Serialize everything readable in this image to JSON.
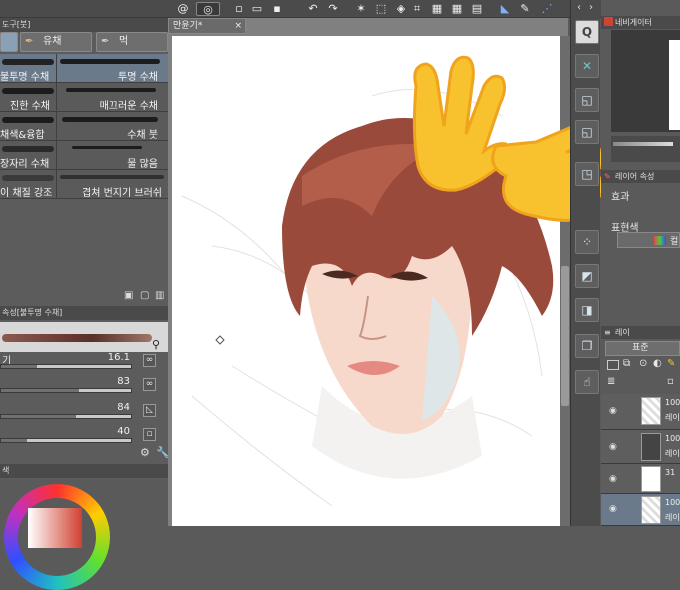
{
  "toolbar": {
    "icons": [
      "spiral-icon",
      "new-file-icon",
      "open-folder-icon",
      "save-icon",
      "undo-icon",
      "redo-icon",
      "sparkle-icon",
      "transform-icon",
      "bucket-icon",
      "crop-icon",
      "ruler-icon",
      "pen-icon"
    ]
  },
  "brush_panel": {
    "title": "도구[붓]",
    "tabs": [
      {
        "label": "유채"
      },
      {
        "label": "먹"
      }
    ],
    "brushes": [
      {
        "left": "불투명 수채",
        "right": "투명 수채",
        "selected": true
      },
      {
        "left": "진한 수채",
        "right": "매끄러운 수채",
        "selected": false
      },
      {
        "left": "채색&융합",
        "right": "수채 붓",
        "selected": false
      },
      {
        "left": "장자리 수채",
        "right": "물 많음",
        "selected": false
      },
      {
        "left": "이 채질 강조",
        "right": "겹쳐 번지기 브러쉬",
        "selected": false
      }
    ]
  },
  "property_panel": {
    "title": "속성[불투명 수채]",
    "sliders": [
      {
        "label": "기",
        "value": "16.1",
        "fraction": 0.28
      },
      {
        "label": "",
        "value": "83",
        "fraction": 0.6
      },
      {
        "label": "",
        "value": "84",
        "fraction": 0.58
      },
      {
        "label": "",
        "value": "40",
        "fraction": 0.2
      }
    ],
    "color_title": "색"
  },
  "document": {
    "tab_label": "만윤기*"
  },
  "navigator": {
    "title": "네비게이터"
  },
  "layer_property": {
    "title": "레이어 속성",
    "effect_label": "효과",
    "expression_label": "표현색",
    "expression_value": "컬"
  },
  "layer_panel": {
    "title": "레이",
    "blend_mode": "표준",
    "layers": [
      {
        "line1": "100",
        "line2": "레이"
      },
      {
        "line1": "100",
        "line2": "레이"
      },
      {
        "line1": "31",
        "line2": ""
      },
      {
        "line1": "100",
        "line2": "레이"
      }
    ]
  },
  "colors": {
    "accent": "#6a7a8a",
    "emoji_yellow": "#f7c22d",
    "emoji_orange": "#f0a31c"
  }
}
